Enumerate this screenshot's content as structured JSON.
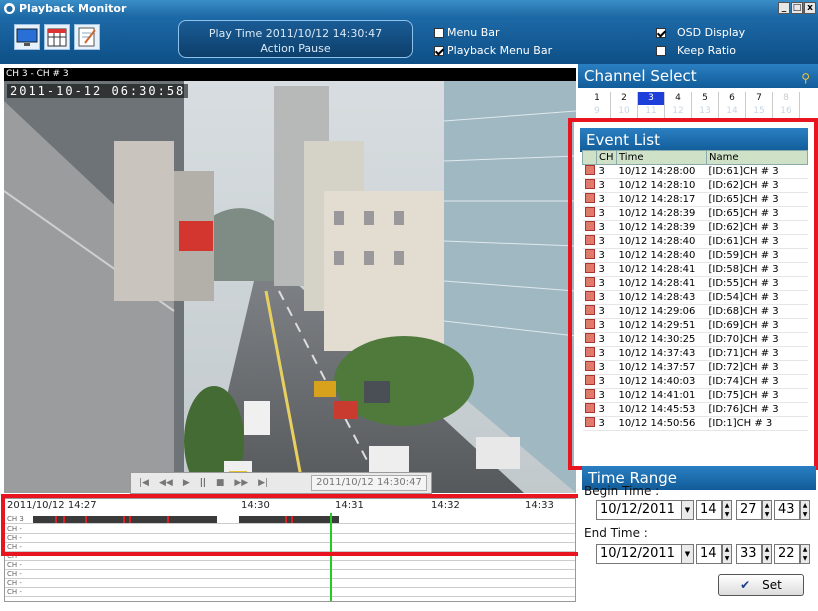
{
  "window": {
    "title": "Playback Monitor",
    "buttons": [
      "_",
      "□",
      "x"
    ]
  },
  "toolbar": {
    "icons": [
      "monitor-icon",
      "calendar-icon",
      "notepad-icon"
    ],
    "play_time": "Play Time 2011/10/12 14:30:47",
    "action": "Action Pause",
    "menu_bar": {
      "label": "Menu Bar",
      "checked": false
    },
    "playback_menu_bar": {
      "label": "Playback Menu Bar",
      "checked": true
    },
    "osd_display": {
      "label": "OSD Display",
      "checked": true
    },
    "keep_ratio": {
      "label": "Keep Ratio",
      "checked": false
    }
  },
  "video": {
    "channel_label": "CH 3 - CH # 3",
    "osd_time": "2011-10-12 06:30:58",
    "player_time": "2011/10/12 14:30:47"
  },
  "timeline": {
    "start": "2011/10/12 14:27",
    "ticks": [
      "14:30",
      "14:31",
      "14:32",
      "14:33"
    ],
    "rows": [
      "CH  3",
      "CH  -",
      "CH  -",
      "CH  -",
      "CH  -",
      "CH  -",
      "CH  -",
      "CH  -",
      "CH  -",
      "CH  -"
    ]
  },
  "channel_select": {
    "title": "Channel Select",
    "row1": [
      "1",
      "2",
      "3",
      "4",
      "5",
      "6",
      "7",
      "8"
    ],
    "row2": [
      "9",
      "10",
      "11",
      "12",
      "13",
      "14",
      "15",
      "16"
    ],
    "selected": "3"
  },
  "event_list": {
    "title": "Event List",
    "columns": [
      "",
      "CH",
      "Time",
      "Name"
    ],
    "rows": [
      [
        "3",
        "10/12 14:28:00",
        "[ID:61]CH # 3"
      ],
      [
        "3",
        "10/12 14:28:10",
        "[ID:62]CH # 3"
      ],
      [
        "3",
        "10/12 14:28:17",
        "[ID:65]CH # 3"
      ],
      [
        "3",
        "10/12 14:28:39",
        "[ID:65]CH # 3"
      ],
      [
        "3",
        "10/12 14:28:39",
        "[ID:62]CH # 3"
      ],
      [
        "3",
        "10/12 14:28:40",
        "[ID:61]CH # 3"
      ],
      [
        "3",
        "10/12 14:28:40",
        "[ID:59]CH # 3"
      ],
      [
        "3",
        "10/12 14:28:41",
        "[ID:58]CH # 3"
      ],
      [
        "3",
        "10/12 14:28:41",
        "[ID:55]CH # 3"
      ],
      [
        "3",
        "10/12 14:28:43",
        "[ID:54]CH # 3"
      ],
      [
        "3",
        "10/12 14:29:06",
        "[ID:68]CH # 3"
      ],
      [
        "3",
        "10/12 14:29:51",
        "[ID:69]CH # 3"
      ],
      [
        "3",
        "10/12 14:30:25",
        "[ID:70]CH # 3"
      ],
      [
        "3",
        "10/12 14:37:43",
        "[ID:71]CH # 3"
      ],
      [
        "3",
        "10/12 14:37:57",
        "[ID:72]CH # 3"
      ],
      [
        "3",
        "10/12 14:40:03",
        "[ID:74]CH # 3"
      ],
      [
        "3",
        "10/12 14:41:01",
        "[ID:75]CH # 3"
      ],
      [
        "3",
        "10/12 14:45:53",
        "[ID:76]CH # 3"
      ],
      [
        "3",
        "10/12 14:50:56",
        "[ID:1]CH # 3"
      ]
    ]
  },
  "time_range": {
    "title": "Time Range",
    "begin_label": "Begin Time :",
    "begin_date": "10/12/2011",
    "begin_h": "14",
    "begin_m": "27",
    "begin_s": "43",
    "end_label": "End Time :",
    "end_date": "10/12/2011",
    "end_h": "14",
    "end_m": "33",
    "end_s": "22",
    "set_label": "Set"
  },
  "colors": {
    "accent": "#1f6aa5",
    "highlight": "#e8141f",
    "selected_channel": "#1b3fd8",
    "cursor": "#22cc22"
  }
}
